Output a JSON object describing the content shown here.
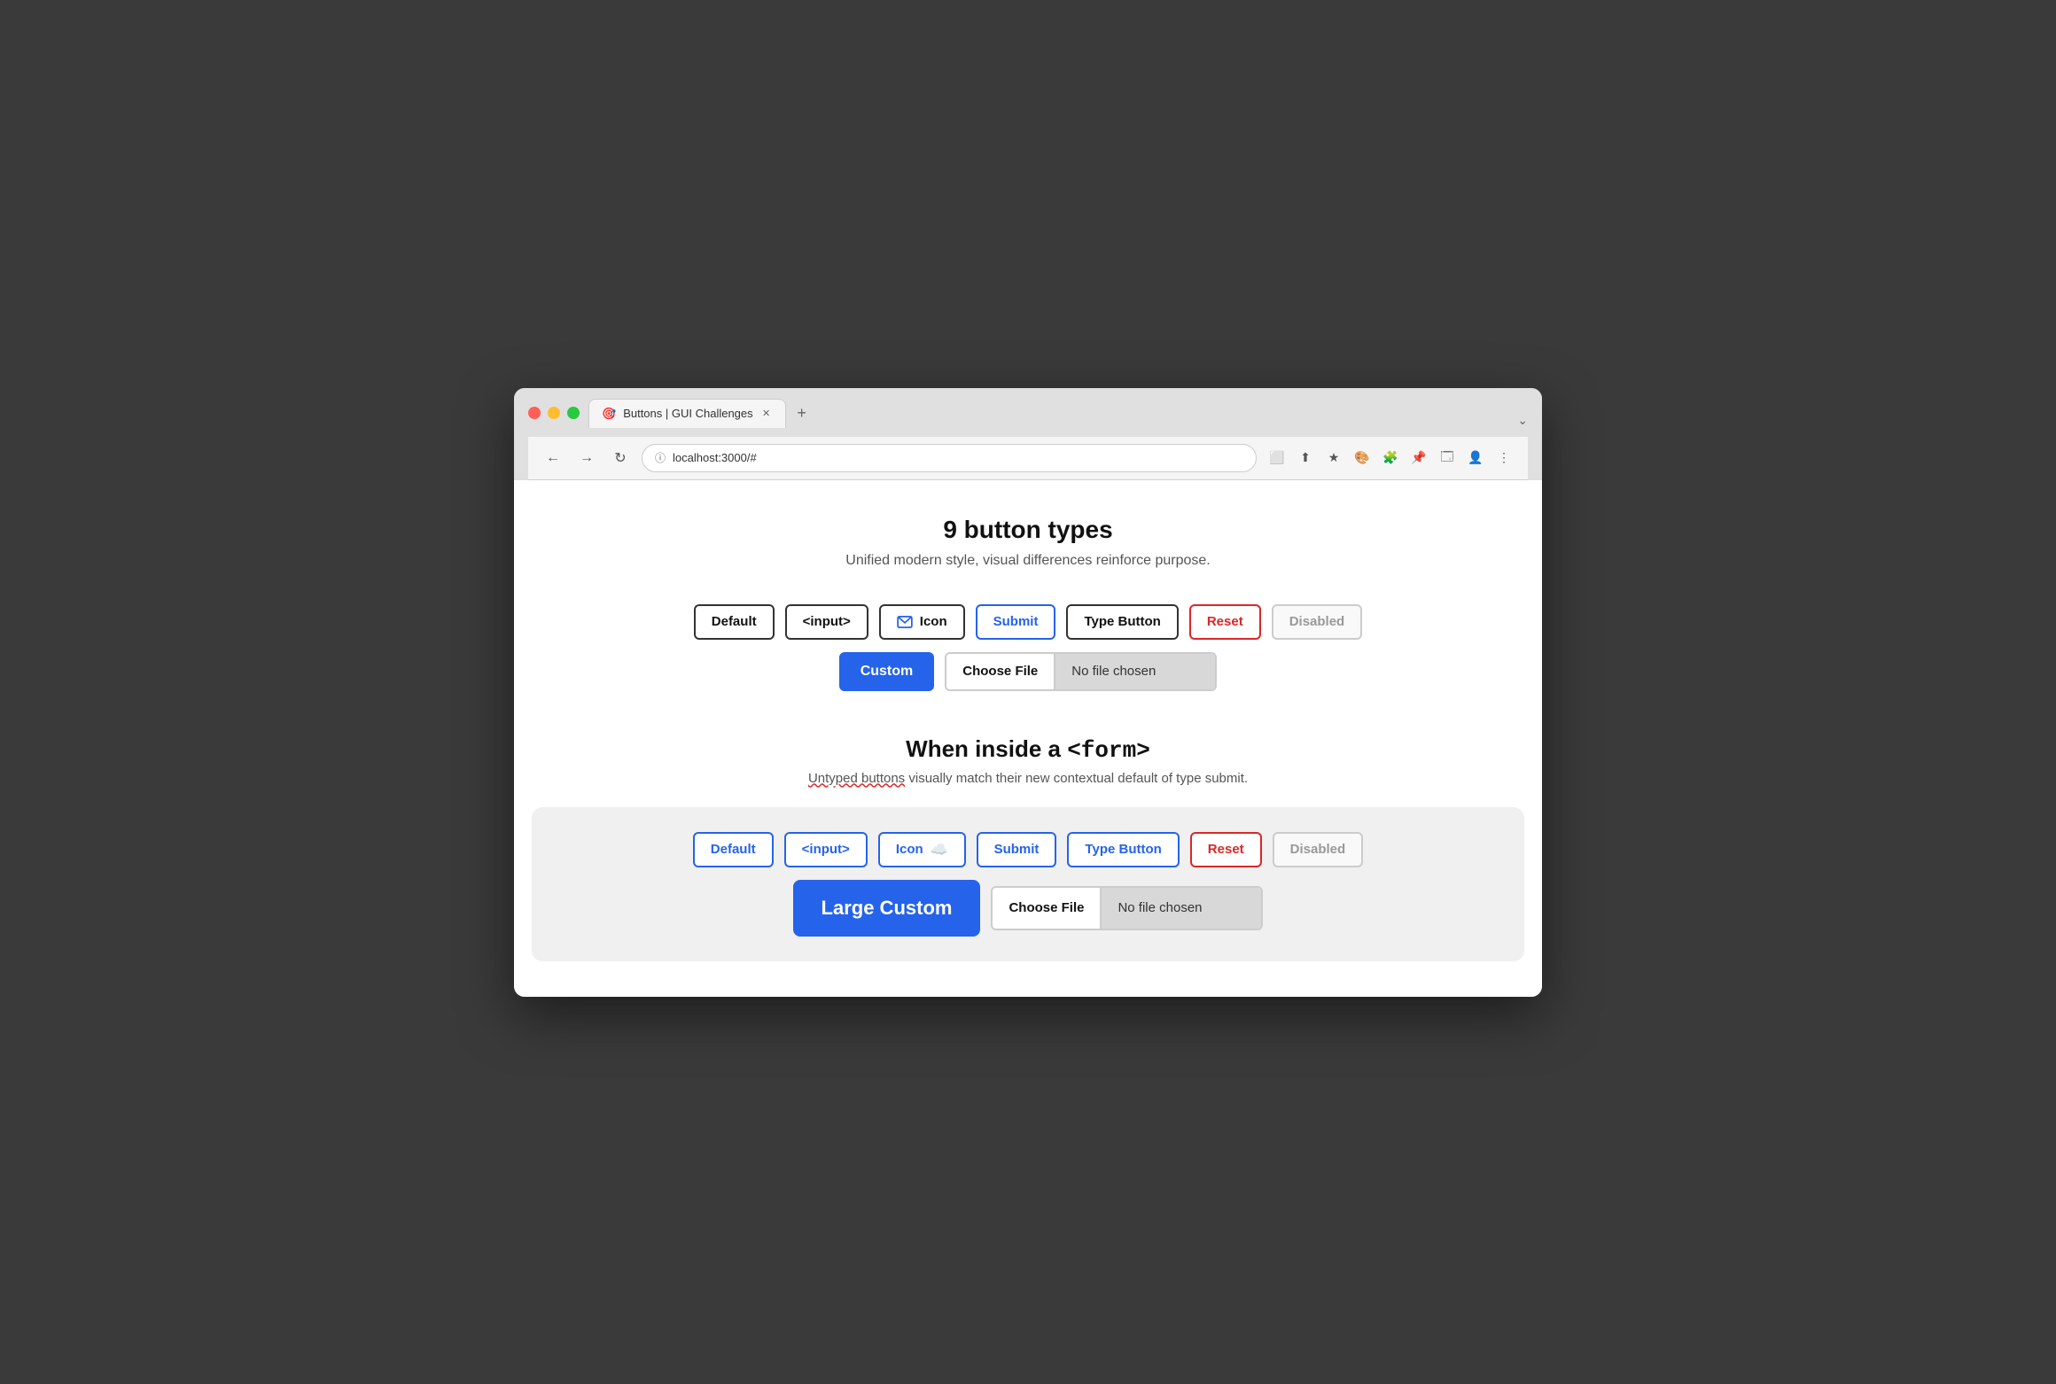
{
  "browser": {
    "traffic_lights": [
      "red",
      "yellow",
      "green"
    ],
    "tab": {
      "title": "Buttons | GUI Challenges",
      "icon": "🎯"
    },
    "new_tab_label": "+",
    "chevron": "⌄",
    "nav": {
      "back": "←",
      "forward": "→",
      "reload": "↻",
      "address": "localhost:3000/#"
    },
    "toolbar_icons": [
      "⬜",
      "⬆",
      "★",
      "🎨",
      "🧩",
      "📌",
      "🗔",
      "👤",
      "⋮"
    ]
  },
  "page": {
    "title": "9 button types",
    "subtitle": "Unified modern style, visual differences reinforce purpose.",
    "section1": {
      "buttons": [
        {
          "label": "Default",
          "type": "default"
        },
        {
          "label": "<input>",
          "type": "input"
        },
        {
          "label": "Icon",
          "type": "icon"
        },
        {
          "label": "Submit",
          "type": "submit"
        },
        {
          "label": "Type Button",
          "type": "type-button"
        },
        {
          "label": "Reset",
          "type": "reset"
        },
        {
          "label": "Disabled",
          "type": "disabled"
        }
      ],
      "custom_btn": "Custom",
      "file_btn": "Choose File",
      "no_file": "No file chosen"
    },
    "section2": {
      "title": "When inside a ",
      "title_code": "<form>",
      "subtitle_part1": "Untyped buttons",
      "subtitle_part2": " visually match their new contextual default of type submit.",
      "buttons": [
        {
          "label": "Default",
          "type": "default"
        },
        {
          "label": "<input>",
          "type": "input"
        },
        {
          "label": "Icon",
          "type": "icon"
        },
        {
          "label": "Submit",
          "type": "submit"
        },
        {
          "label": "Type Button",
          "type": "type-button"
        },
        {
          "label": "Reset",
          "type": "reset"
        },
        {
          "label": "Disabled",
          "type": "disabled"
        }
      ],
      "custom_btn": "Large Custom",
      "file_btn": "Choose File",
      "no_file": "No file chosen"
    }
  }
}
